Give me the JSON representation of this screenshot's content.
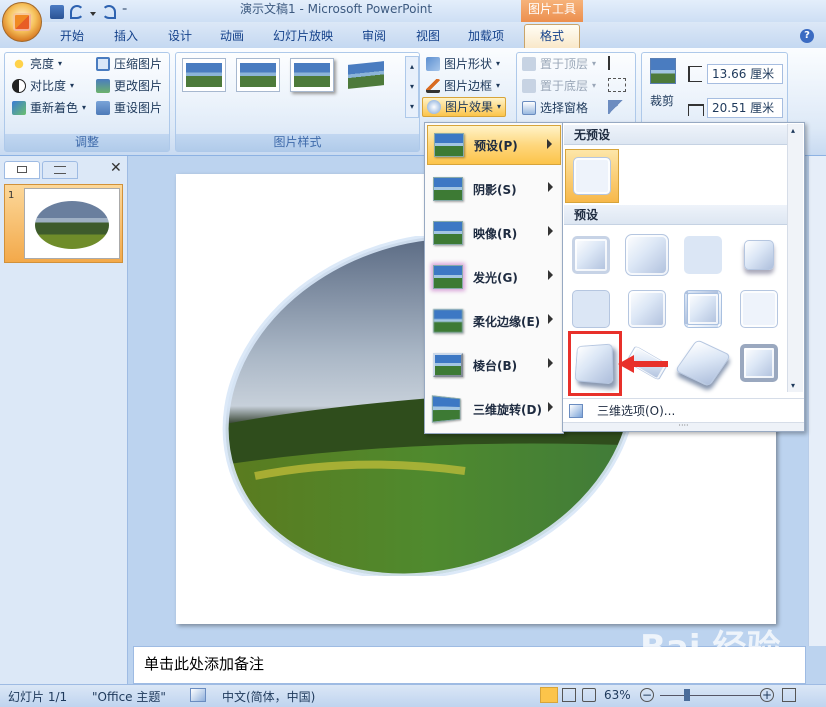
{
  "window": {
    "title": "演示文稿1 - Microsoft PowerPoint",
    "context_tab_group": "图片工具"
  },
  "tabs": [
    "开始",
    "插入",
    "设计",
    "动画",
    "幻灯片放映",
    "审阅",
    "视图",
    "加载项",
    "格式"
  ],
  "active_tab": "格式",
  "ribbon": {
    "adjust": {
      "label": "调整",
      "buttons": [
        "亮度",
        "对比度",
        "重新着色",
        "压缩图片",
        "更改图片",
        "重设图片"
      ]
    },
    "picture_styles": {
      "label": "图片样式",
      "buttons": [
        "图片形状",
        "图片边框",
        "图片效果"
      ]
    },
    "arrange": {
      "buttons": [
        "置于顶层",
        "置于底层",
        "选择窗格"
      ]
    },
    "size": {
      "crop_label": "裁剪",
      "height_value": "13.66 厘米",
      "width_value": "20.51 厘米"
    }
  },
  "effects_menu": {
    "items": [
      "预设(P)",
      "阴影(S)",
      "映像(R)",
      "发光(G)",
      "柔化边缘(E)",
      "棱台(B)",
      "三维旋转(D)"
    ],
    "active_item": "预设(P)"
  },
  "preset_gallery": {
    "no_preset_header": "无预设",
    "preset_header": "预设",
    "options_label": "三维选项(O)...",
    "highlighted_index": 8,
    "preset_count": 12
  },
  "slide_pane": {
    "slide_number": "1"
  },
  "notes_placeholder": "单击此处添加备注",
  "status": {
    "slide_info": "幻灯片 1/1",
    "theme": "\"Office 主题\"",
    "language": "中文(简体，中国)",
    "zoom": "63%"
  },
  "watermark": "Bai 经验"
}
